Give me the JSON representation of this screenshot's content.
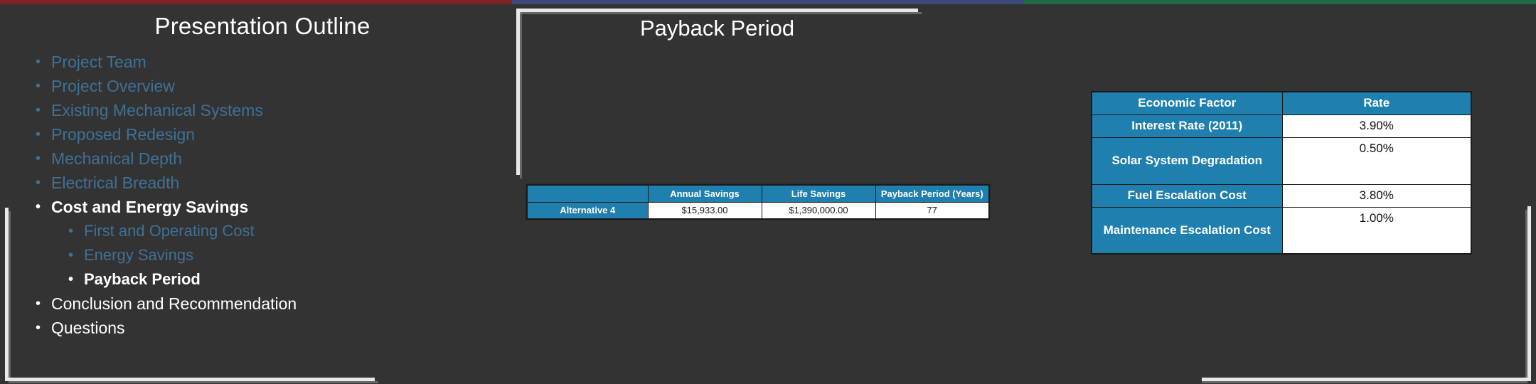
{
  "slide": {
    "accent_blue": "#1f7fae",
    "dim_text_color": "#3f7196",
    "background": "#333333",
    "top_strips": [
      {
        "name": "red-strip",
        "color": "#7f2222"
      },
      {
        "name": "blue-strip",
        "color": "#3b4a79"
      },
      {
        "name": "green-strip",
        "color": "#1e6b45"
      }
    ]
  },
  "outline": {
    "title": "Presentation Outline",
    "items": [
      {
        "label": "Project Team",
        "state": "dim",
        "level": 1
      },
      {
        "label": "Project Overview",
        "state": "dim",
        "level": 1
      },
      {
        "label": "Existing Mechanical Systems",
        "state": "dim",
        "level": 1
      },
      {
        "label": "Proposed Redesign",
        "state": "dim",
        "level": 1
      },
      {
        "label": "Mechanical Depth",
        "state": "dim",
        "level": 1
      },
      {
        "label": "Electrical Breadth",
        "state": "dim",
        "level": 1
      },
      {
        "label": "Cost and Energy Savings",
        "state": "active",
        "level": 1
      },
      {
        "label": "First and Operating Cost",
        "state": "dim",
        "level": 2
      },
      {
        "label": "Energy Savings",
        "state": "dim",
        "level": 2
      },
      {
        "label": "Payback Period",
        "state": "active",
        "level": 2
      },
      {
        "label": "Conclusion and Recommendation",
        "state": "plain",
        "level": 1
      },
      {
        "label": "Questions",
        "state": "plain",
        "level": 1
      }
    ],
    "bullet_glyph": "•"
  },
  "content": {
    "title": "Payback Period"
  },
  "savings_table": {
    "headers": [
      "",
      "Annual Savings",
      "Life Savings",
      "Payback Period (Years)"
    ],
    "rows": [
      {
        "label": "Alternative 4",
        "annual_savings": "$15,933.00",
        "life_savings": "$1,390,000.00",
        "payback_period_years": "77"
      }
    ]
  },
  "economic_table": {
    "headers": [
      "Economic Factor",
      "Rate"
    ],
    "rows": [
      {
        "factor": "Interest Rate (2011)",
        "rate": "3.90%"
      },
      {
        "factor": "Solar System Degradation",
        "rate": "0.50%"
      },
      {
        "factor": "Fuel Escalation Cost",
        "rate": "3.80%"
      },
      {
        "factor": "Maintenance Escalation Cost",
        "rate": "1.00%"
      }
    ]
  }
}
